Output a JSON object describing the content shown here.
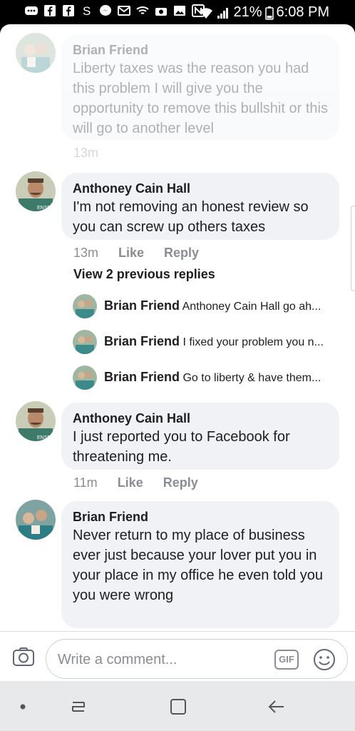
{
  "status_bar": {
    "battery": "21%",
    "time": "6:08 PM"
  },
  "comments": [
    {
      "name": "Brian Friend",
      "text": "Liberty taxes was the reason you had this problem I will give you the opportunity to remove this bullshit or this will go to another level",
      "time": "13m"
    },
    {
      "name": "Anthoney Cain Hall",
      "text": "I'm not removing an honest review so you can screw up others taxes",
      "time": "13m",
      "like": "Like",
      "reply": "Reply"
    },
    {
      "name": "Anthoney Cain Hall",
      "text": "I just reported you to Facebook for threatening me.",
      "time": "11m",
      "like": "Like",
      "reply": "Reply"
    },
    {
      "name": "Brian Friend",
      "text": "Never return to my place of business ever just because your lover put you in your place in my office he even told you you were wrong"
    }
  ],
  "view_replies": "View 2 previous replies",
  "replies": [
    {
      "name": "Brian Friend",
      "text": "Anthoney Cain Hall go ah..."
    },
    {
      "name": "Brian Friend",
      "text": "I fixed your problem you n..."
    },
    {
      "name": "Brian Friend",
      "text": "Go to liberty & have them..."
    }
  ],
  "composer": {
    "placeholder": "Write a comment...",
    "gif": "GIF"
  },
  "icons": [
    "camera-icon",
    "emoji-icon",
    "recent-apps-icon",
    "home-icon",
    "back-icon"
  ],
  "colors": {
    "bubble": "#f0f2f5",
    "meta": "#8a8d91",
    "text": "#1c1e21"
  }
}
